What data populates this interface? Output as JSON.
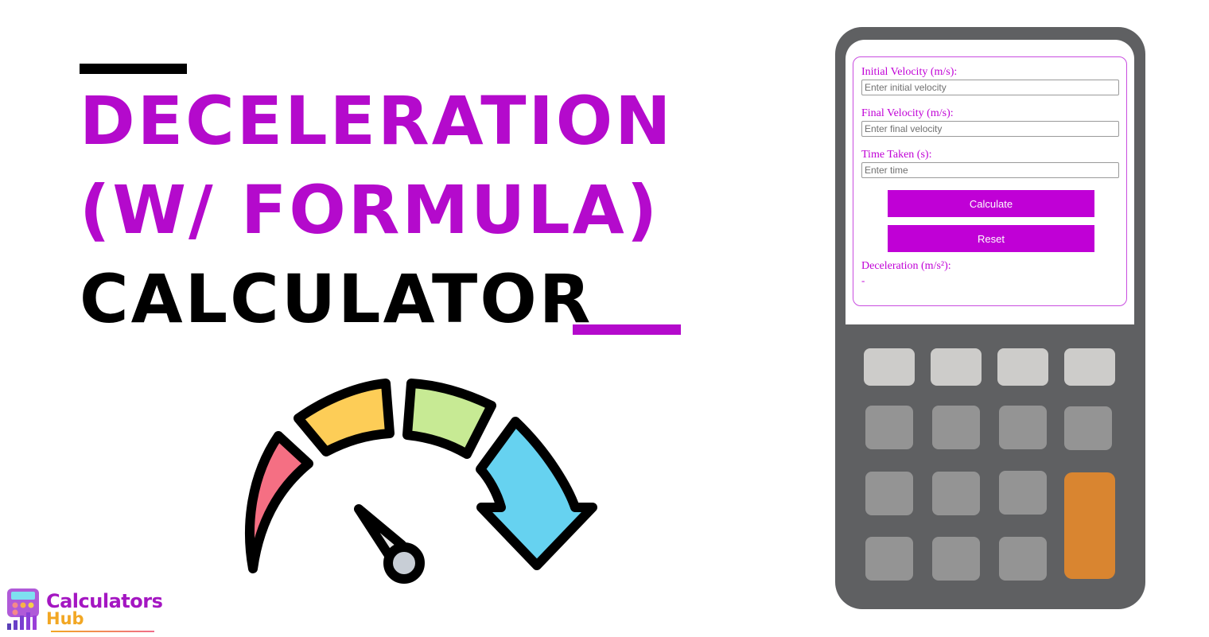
{
  "title": {
    "line1": "Deceleration",
    "line2": "(w/ Formula)",
    "line3": "Calculator"
  },
  "colors": {
    "accent": "#b40acc",
    "button": "#c000d6",
    "device_body": "#5f6062",
    "key_light": "#cdccca",
    "key_mid": "#949494",
    "key_orange": "#d98530",
    "gauge_red": "#f56f83",
    "gauge_yellow": "#fdcd57",
    "gauge_green": "#c7ea94",
    "gauge_blue": "#66d2f0",
    "needle_cap": "#c8ced6"
  },
  "calculator": {
    "fields": [
      {
        "label": "Initial Velocity (m/s):",
        "placeholder": "Enter initial velocity",
        "value": ""
      },
      {
        "label": "Final Velocity (m/s):",
        "placeholder": "Enter final velocity",
        "value": ""
      },
      {
        "label": "Time Taken (s):",
        "placeholder": "Enter time",
        "value": ""
      }
    ],
    "calculate_label": "Calculate",
    "reset_label": "Reset",
    "result_label": "Deceleration (m/s²):",
    "result_value": "-"
  },
  "logo": {
    "line1": "Calculators",
    "line2": "Hub"
  }
}
